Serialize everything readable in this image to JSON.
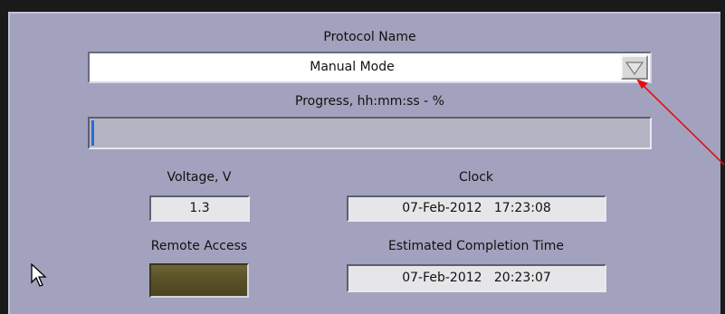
{
  "protocol": {
    "label": "Protocol Name",
    "value": "Manual Mode"
  },
  "progress": {
    "label": "Progress, hh:mm:ss - %",
    "fraction": 0.005,
    "fill_color": "#2a6ad8"
  },
  "voltage": {
    "label": "Voltage, V",
    "value": "1.3"
  },
  "clock": {
    "label": "Clock",
    "value": "07-Feb-2012   17:23:08"
  },
  "remote_access": {
    "label": "Remote Access",
    "indicator_color": "#5a5228"
  },
  "estimated_completion": {
    "label": "Estimated Completion Time",
    "value": "07-Feb-2012   20:23:07"
  },
  "colors": {
    "panel": "#a2a2be",
    "annotation_arrow": "#e01010"
  },
  "icons": {
    "dropdown": "triangle-down-icon",
    "cursor": "mouse-pointer-icon"
  }
}
